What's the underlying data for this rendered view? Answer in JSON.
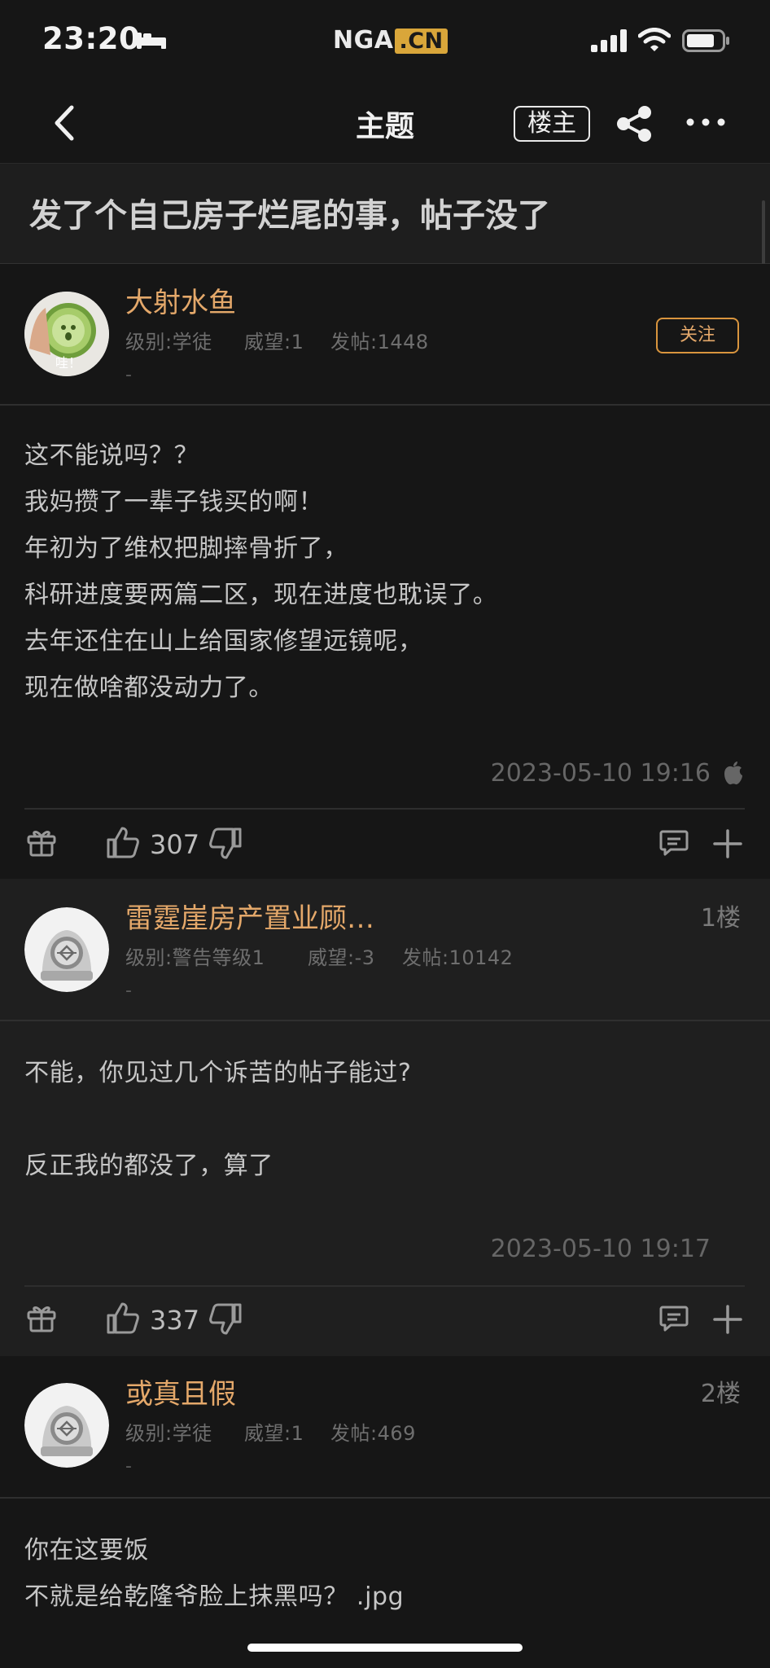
{
  "status": {
    "time": "23:20",
    "brand_main": "NGA",
    "brand_cn": ".CN"
  },
  "nav": {
    "title": "主题",
    "op_label": "楼主"
  },
  "topic": {
    "title": "发了个自己房子烂尾的事，帖子没了"
  },
  "posts": [
    {
      "username": "大射水鱼",
      "level": "级别:学徒",
      "prestige": "威望:1",
      "post_count": "发帖:1448",
      "dash": "-",
      "follow_label": "关注",
      "avatar_caption": "哇！",
      "lines": [
        "这不能说吗？？",
        "我妈攒了一辈子钱买的啊！",
        "年初为了维权把脚摔骨折了，",
        "科研进度要两篇二区，现在进度也耽误了。",
        "去年还住在山上给国家修望远镜呢，",
        "现在做啥都没动力了。"
      ],
      "date": "2023-05-10 19:16",
      "likes": "307"
    },
    {
      "username": "雷霆崖房产置业顾…",
      "floor": "1楼",
      "level": "级别:警告等级1",
      "prestige": "威望:-3",
      "post_count": "发帖:10142",
      "dash": "-",
      "lines": [
        "不能，你见过几个诉苦的帖子能过?",
        "",
        "反正我的都没了，算了"
      ],
      "date": "2023-05-10 19:17",
      "likes": "337"
    },
    {
      "username": "或真且假",
      "floor": "2楼",
      "level": "级别:学徒",
      "prestige": "威望:1",
      "post_count": "发帖:469",
      "dash": "-",
      "lines": [
        "你在这要饭",
        "不就是给乾隆爷脸上抹黑吗？ .jpg"
      ]
    }
  ],
  "colors": {
    "accent": "#e4a86a",
    "background": "#161616",
    "alt_background": "#1f1f1f"
  }
}
